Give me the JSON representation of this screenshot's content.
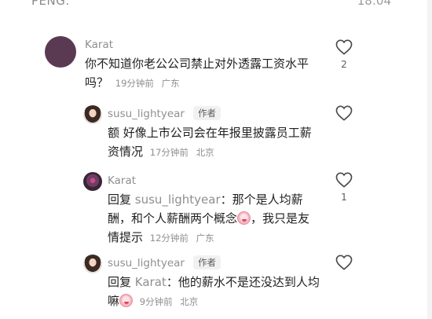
{
  "header": {
    "left_text": "PENG.",
    "time": "18:04"
  },
  "comments": [
    {
      "username": "Karat",
      "text": "你不知道你老公公司禁止对外透露工资水平吗？",
      "time_ago": "19分钟前",
      "location": "广东",
      "likes": "2",
      "avatar": "karat-avatar"
    }
  ],
  "replies": [
    {
      "username": "susu_lightyear",
      "badge": "作者",
      "text": "额 好像上市公司会在年报里披露员工薪资情况",
      "time_ago": "17分钟前",
      "location": "北京",
      "likes": "",
      "avatar": "susu-avatar"
    },
    {
      "username": "Karat",
      "reply_prefix": "回复",
      "reply_target": "susu_lightyear",
      "text_before_emoji": "：那个是人均薪酬，和个人薪酬两个概念",
      "text_after_emoji": "，我只是友情提示",
      "time_ago": "12分钟前",
      "location": "广东",
      "likes": "1",
      "avatar": "karat-avatar"
    },
    {
      "username": "susu_lightyear",
      "badge": "作者",
      "reply_prefix": "回复",
      "reply_target": "Karat",
      "text_before_emoji": "：他的薪水不是还没达到人均嘛",
      "time_ago": "9分钟前",
      "location": "北京",
      "likes": "",
      "avatar": "susu-avatar"
    }
  ]
}
